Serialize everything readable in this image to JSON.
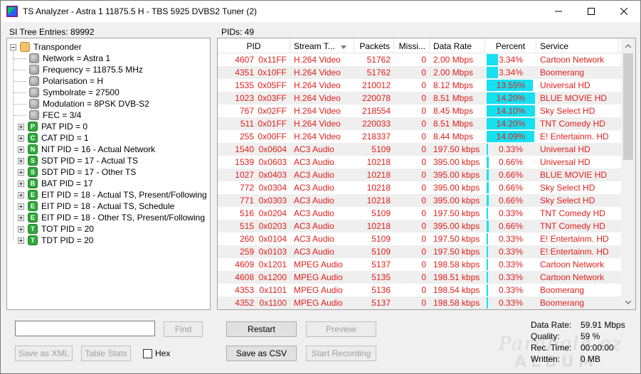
{
  "window": {
    "title": "TS Analyzer - Astra 1 11875.5 H - TBS 5925 DVBS2 Tuner (2)"
  },
  "tree": {
    "header": "SI Tree Entries: 89992",
    "root": "Transponder",
    "children": [
      {
        "label": "Network = Astra 1",
        "icon": "gray",
        "expandable": false
      },
      {
        "label": "Frequency = 11875.5 MHz",
        "icon": "gray",
        "expandable": false
      },
      {
        "label": "Polarisation = H",
        "icon": "gray",
        "expandable": false
      },
      {
        "label": "Symbolrate = 27500",
        "icon": "gray",
        "expandable": false
      },
      {
        "label": "Modulation = 8PSK DVB-S2",
        "icon": "gray",
        "expandable": false
      },
      {
        "label": "FEC = 3/4",
        "icon": "gray",
        "expandable": false
      },
      {
        "label": "PAT PID = 0",
        "icon": "green",
        "letter": "P",
        "expandable": true
      },
      {
        "label": "CAT PID = 1",
        "icon": "green",
        "letter": "C",
        "expandable": true
      },
      {
        "label": "NIT PID = 16 - Actual Network",
        "icon": "green",
        "letter": "N",
        "expandable": true
      },
      {
        "label": "SDT PID = 17 - Actual TS",
        "icon": "green",
        "letter": "S",
        "expandable": true
      },
      {
        "label": "SDT PID = 17 - Other TS",
        "icon": "green",
        "letter": "S",
        "expandable": true
      },
      {
        "label": "BAT PID = 17",
        "icon": "green",
        "letter": "B",
        "expandable": true
      },
      {
        "label": "EIT PID = 18 - Actual TS, Present/Following",
        "icon": "green",
        "letter": "E",
        "expandable": true
      },
      {
        "label": "EIT PID = 18 - Actual TS, Schedule",
        "icon": "green",
        "letter": "E",
        "expandable": true
      },
      {
        "label": "EIT PID = 18 - Other TS, Present/Following",
        "icon": "green",
        "letter": "E",
        "expandable": true
      },
      {
        "label": "TOT PID = 20",
        "icon": "green",
        "letter": "T",
        "expandable": true
      },
      {
        "label": "TDT PID = 20",
        "icon": "green",
        "letter": "T",
        "expandable": true
      }
    ]
  },
  "left_controls": {
    "search_value": "",
    "find_label": "Find",
    "save_xml_label": "Save as XML",
    "table_stats_label": "Table Stats",
    "hex_label": "Hex"
  },
  "pids": {
    "header": "PIDs: 49",
    "columns": [
      "PID",
      "Stream T...",
      "Packets",
      "Missi...",
      "Data Rate",
      "Percent",
      "Service"
    ],
    "rows": [
      {
        "pid": "4607",
        "hex": "0x11FF",
        "type": "H.264 Video",
        "packets": "51762",
        "missing": "0",
        "rate": "2.00 Mbps",
        "percent": "3.34%",
        "pct": 3.34,
        "service": "Cartoon Network"
      },
      {
        "pid": "4351",
        "hex": "0x10FF",
        "type": "H.264 Video",
        "packets": "51762",
        "missing": "0",
        "rate": "2.00 Mbps",
        "percent": "3.34%",
        "pct": 3.34,
        "service": "Boomerang"
      },
      {
        "pid": "1535",
        "hex": "0x05FF",
        "type": "H.264 Video",
        "packets": "210012",
        "missing": "0",
        "rate": "8.12 Mbps",
        "percent": "13.55%",
        "pct": 13.55,
        "service": "Universal HD"
      },
      {
        "pid": "1023",
        "hex": "0x03FF",
        "type": "H.264 Video",
        "packets": "220078",
        "missing": "0",
        "rate": "8.51 Mbps",
        "percent": "14.20%",
        "pct": 14.2,
        "service": "BLUE MOVIE HD"
      },
      {
        "pid": "767",
        "hex": "0x02FF",
        "type": "H.264 Video",
        "packets": "218554",
        "missing": "0",
        "rate": "8.45 Mbps",
        "percent": "14.10%",
        "pct": 14.1,
        "service": "Sky Select HD"
      },
      {
        "pid": "511",
        "hex": "0x01FF",
        "type": "H.264 Video",
        "packets": "220033",
        "missing": "0",
        "rate": "8.51 Mbps",
        "percent": "14.20%",
        "pct": 14.2,
        "service": "TNT Comedy HD"
      },
      {
        "pid": "255",
        "hex": "0x00FF",
        "type": "H.264 Video",
        "packets": "218337",
        "missing": "0",
        "rate": "8.44 Mbps",
        "percent": "14.09%",
        "pct": 14.09,
        "service": "E! Entertainm. HD"
      },
      {
        "pid": "1540",
        "hex": "0x0604",
        "type": "AC3 Audio",
        "packets": "5109",
        "missing": "0",
        "rate": "197.50 kbps",
        "percent": "0.33%",
        "pct": 0.33,
        "service": "Universal HD"
      },
      {
        "pid": "1539",
        "hex": "0x0603",
        "type": "AC3 Audio",
        "packets": "10218",
        "missing": "0",
        "rate": "395.00 kbps",
        "percent": "0.66%",
        "pct": 0.66,
        "service": "Universal HD"
      },
      {
        "pid": "1027",
        "hex": "0x0403",
        "type": "AC3 Audio",
        "packets": "10218",
        "missing": "0",
        "rate": "395.00 kbps",
        "percent": "0.66%",
        "pct": 0.66,
        "service": "BLUE MOVIE HD"
      },
      {
        "pid": "772",
        "hex": "0x0304",
        "type": "AC3 Audio",
        "packets": "10218",
        "missing": "0",
        "rate": "395.00 kbps",
        "percent": "0.66%",
        "pct": 0.66,
        "service": "Sky Select HD"
      },
      {
        "pid": "771",
        "hex": "0x0303",
        "type": "AC3 Audio",
        "packets": "10218",
        "missing": "0",
        "rate": "395.00 kbps",
        "percent": "0.66%",
        "pct": 0.66,
        "service": "Sky Select HD"
      },
      {
        "pid": "516",
        "hex": "0x0204",
        "type": "AC3 Audio",
        "packets": "5109",
        "missing": "0",
        "rate": "197.50 kbps",
        "percent": "0.33%",
        "pct": 0.33,
        "service": "TNT Comedy HD"
      },
      {
        "pid": "515",
        "hex": "0x0203",
        "type": "AC3 Audio",
        "packets": "10218",
        "missing": "0",
        "rate": "395.00 kbps",
        "percent": "0.66%",
        "pct": 0.66,
        "service": "TNT Comedy HD"
      },
      {
        "pid": "260",
        "hex": "0x0104",
        "type": "AC3 Audio",
        "packets": "5109",
        "missing": "0",
        "rate": "197.50 kbps",
        "percent": "0.33%",
        "pct": 0.33,
        "service": "E! Entertainm. HD"
      },
      {
        "pid": "259",
        "hex": "0x0103",
        "type": "AC3 Audio",
        "packets": "5109",
        "missing": "0",
        "rate": "197.50 kbps",
        "percent": "0.33%",
        "pct": 0.33,
        "service": "E! Entertainm. HD"
      },
      {
        "pid": "4609",
        "hex": "0x1201",
        "type": "MPEG Audio",
        "packets": "5137",
        "missing": "0",
        "rate": "198.58 kbps",
        "percent": "0.33%",
        "pct": 0.33,
        "service": "Cartoon Network"
      },
      {
        "pid": "4608",
        "hex": "0x1200",
        "type": "MPEG Audio",
        "packets": "5135",
        "missing": "0",
        "rate": "198.51 kbps",
        "percent": "0.33%",
        "pct": 0.33,
        "service": "Cartoon Network"
      },
      {
        "pid": "4353",
        "hex": "0x1101",
        "type": "MPEG Audio",
        "packets": "5136",
        "missing": "0",
        "rate": "198.54 kbps",
        "percent": "0.33%",
        "pct": 0.33,
        "service": "Boomerang"
      },
      {
        "pid": "4352",
        "hex": "0x1100",
        "type": "MPEG Audio",
        "packets": "5137",
        "missing": "0",
        "rate": "198.58 kbps",
        "percent": "0.33%",
        "pct": 0.33,
        "service": "Boomerang"
      }
    ]
  },
  "bottom_controls": {
    "restart_label": "Restart",
    "preview_label": "Preview",
    "save_csv_label": "Save as CSV",
    "start_recording_label": "Start Recording"
  },
  "stats": {
    "data_rate_label": "Data Rate:",
    "data_rate_value": "59.91 Mbps",
    "quality_label": "Quality:",
    "quality_value": "59 %",
    "rec_time_label": "Rec. Time:",
    "rec_time_value": "00:00:00",
    "written_label": "Written:",
    "written_value": "0 MB"
  },
  "watermark": {
    "line1": "Parabola.cz",
    "line2": "ALBUM"
  },
  "colors": {
    "row_text": "#e0201c",
    "percent_bar": "#14e0f0",
    "alt_row": "#efefef"
  }
}
